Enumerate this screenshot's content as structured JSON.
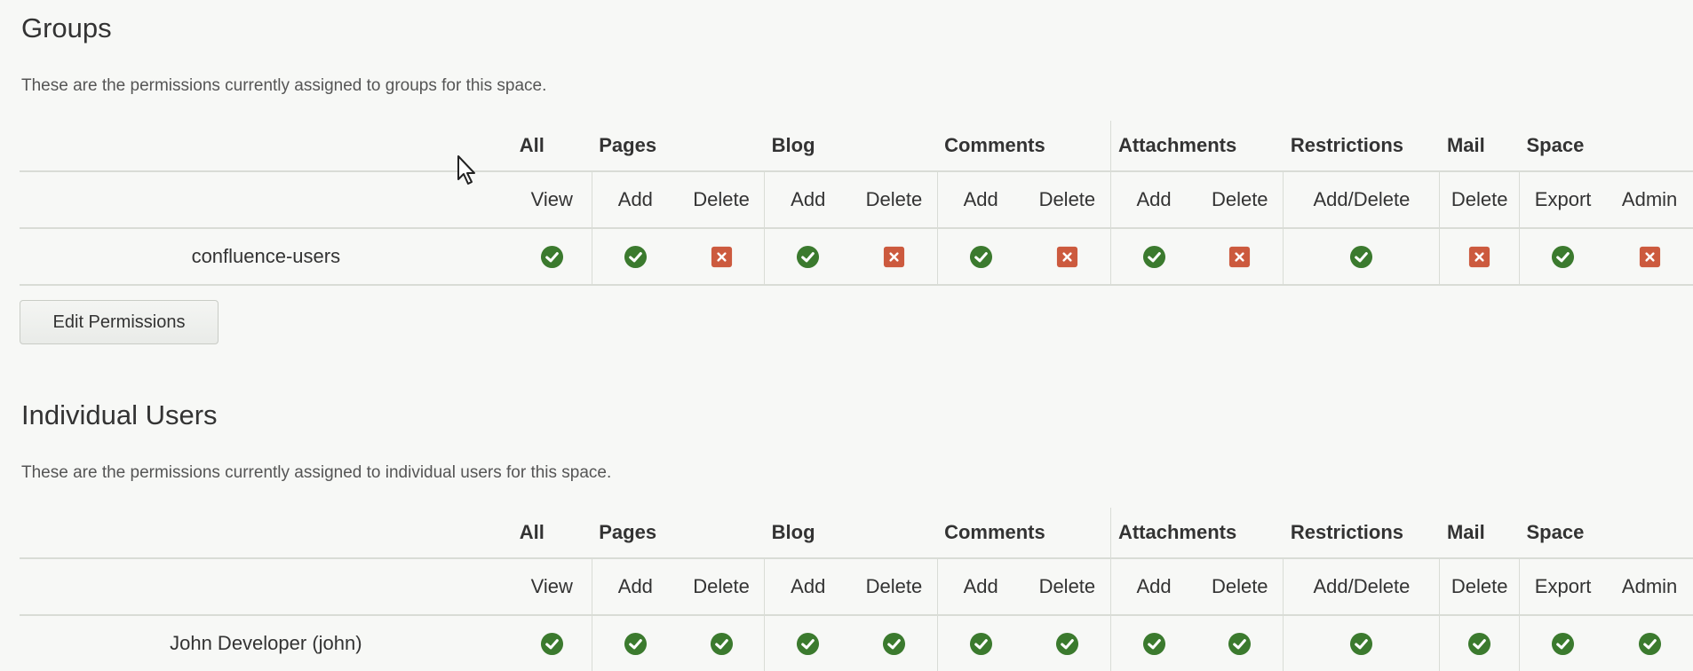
{
  "groups_section": {
    "title": "Groups",
    "description": "These are the permissions currently assigned to groups for this space.",
    "edit_button": "Edit Permissions",
    "rows": [
      {
        "name": "confluence-users",
        "perms": [
          true,
          true,
          false,
          true,
          false,
          true,
          false,
          true,
          false,
          true,
          false,
          true,
          false
        ]
      }
    ]
  },
  "users_section": {
    "title": "Individual Users",
    "description": "These are the permissions currently assigned to individual users for this space.",
    "rows": [
      {
        "name": "John Developer (john)",
        "perms": [
          true,
          true,
          true,
          true,
          true,
          true,
          true,
          true,
          true,
          true,
          true,
          true,
          true
        ]
      }
    ]
  },
  "columns": {
    "groups": [
      "All",
      "Pages",
      "Blog",
      "Comments",
      "Attachments",
      "Restrictions",
      "Mail",
      "Space"
    ],
    "subs": [
      "View",
      "Add",
      "Delete",
      "Add",
      "Delete",
      "Add",
      "Delete",
      "Add",
      "Delete",
      "Add/Delete",
      "Delete",
      "Export",
      "Admin"
    ]
  },
  "colors": {
    "allowed": "#3b7a2e",
    "denied": "#cc5a3e"
  },
  "icons": {
    "allowed": "check-circle-icon",
    "denied": "cross-square-icon",
    "cursor": "mouse-pointer-icon"
  }
}
